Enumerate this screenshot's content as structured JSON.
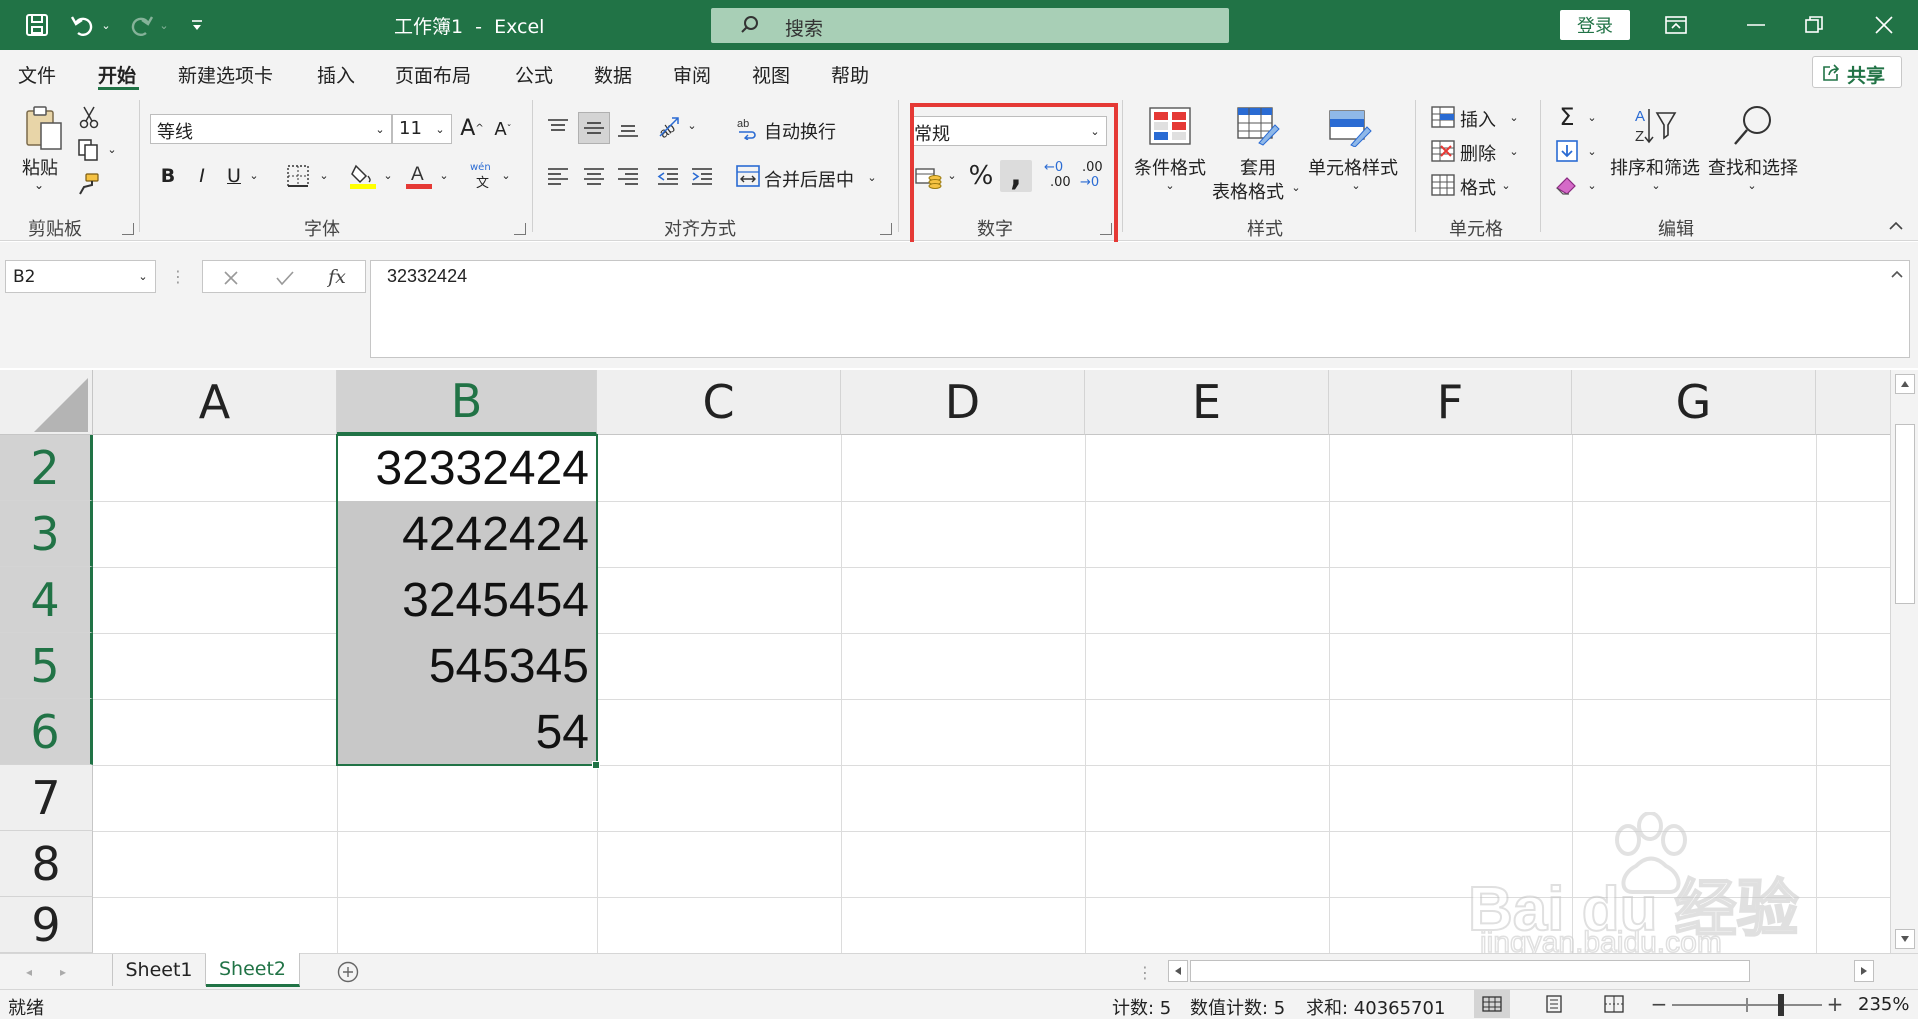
{
  "window": {
    "title": "工作簿1  -  Excel",
    "search_placeholder": "搜索",
    "login_label": "登录"
  },
  "menu": {
    "file": "文件",
    "home": "开始",
    "new_tab": "新建选项卡",
    "insert": "插入",
    "page_layout": "页面布局",
    "formulas": "公式",
    "data": "数据",
    "review": "审阅",
    "view": "视图",
    "help": "帮助",
    "share": "共享"
  },
  "ribbon": {
    "clipboard": {
      "paste": "粘贴",
      "group": "剪贴板"
    },
    "font": {
      "name": "等线",
      "size": "11",
      "group": "字体",
      "bold": "B",
      "italic": "I",
      "underline": "U",
      "phonetic_top": "wén",
      "phonetic_bottom": "文"
    },
    "alignment": {
      "wrap_text": "自动换行",
      "merge_center": "合并后居中",
      "group": "对齐方式"
    },
    "number": {
      "format": "常规",
      "percent": "%",
      "comma": ",",
      "inc_dec_top": "←0",
      "inc_dec_bottom": ".00",
      "dec_dec_top": ".00",
      "dec_dec_bottom": "→0",
      "group": "数字"
    },
    "styles": {
      "conditional": "条件格式",
      "table_format_1": "套用",
      "table_format_2": "表格格式",
      "cell_styles": "单元格样式",
      "group": "样式"
    },
    "cells": {
      "insert": "插入",
      "delete": "删除",
      "format": "格式",
      "group": "单元格"
    },
    "editing": {
      "sort_filter": "排序和筛选",
      "find_select": "查找和选择",
      "group": "编辑"
    }
  },
  "formula_bar": {
    "name_box": "B2",
    "fx": "fx",
    "value": "32332424"
  },
  "sheet": {
    "columns": [
      "A",
      "B",
      "C",
      "D",
      "E",
      "F",
      "G"
    ],
    "rows": [
      "2",
      "3",
      "4",
      "5",
      "6",
      "7",
      "8",
      "9"
    ],
    "b_values": [
      "32332424",
      "4242424",
      "3245454",
      "545345",
      "54"
    ]
  },
  "tabs": [
    "Sheet1",
    "Sheet2"
  ],
  "status": {
    "ready": "就绪",
    "count": "计数: 5",
    "numeric_count": "数值计数: 5",
    "sum": "求和: 40365701",
    "zoom": "235%"
  },
  "watermark": {
    "text": "Bai du 经验",
    "url": "jingyan.baidu.com"
  },
  "colors": {
    "excel_green": "#217346",
    "highlight_red": "#e53935",
    "selection_gray": "#c8c8c8"
  }
}
